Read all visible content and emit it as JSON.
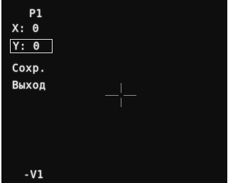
{
  "menu": {
    "title": "P1",
    "x_label": "X: 0",
    "y_label": "Y: 0",
    "save_label": "Сохр.",
    "exit_label": "Выход"
  },
  "footer": {
    "version": "-V1"
  },
  "crosshair": {
    "icon": "crosshair-icon"
  },
  "colors": {
    "background": "#0e0e0e",
    "text": "#e6e6e6",
    "crosshair": "#8d8d8d"
  }
}
